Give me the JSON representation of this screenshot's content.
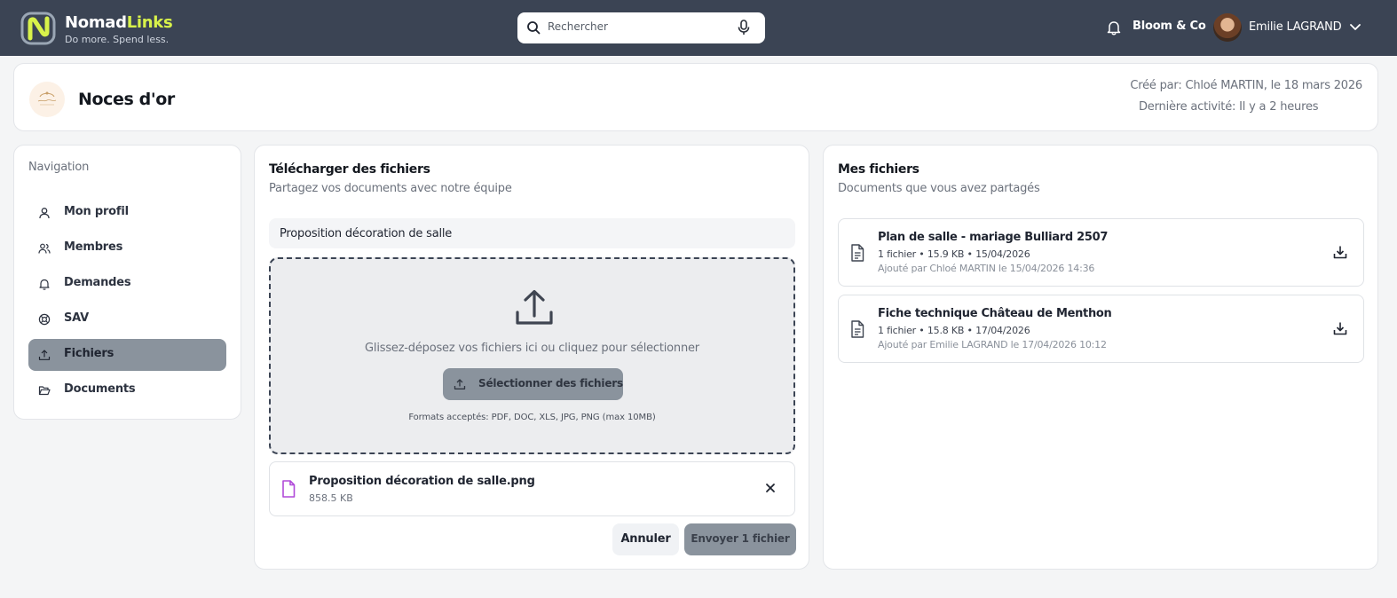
{
  "app": {
    "brand_part1": "Nomad",
    "brand_part2": "Links",
    "tagline": "Do more. Spend less.",
    "accent_color": "#d8f24a",
    "topbar_color": "#3b4454"
  },
  "search": {
    "placeholder": "Rechercher",
    "icon": "search-icon",
    "mic_icon": "microphone-icon"
  },
  "user": {
    "organization": "Bloom & Co",
    "name": "Emilie LAGRAND"
  },
  "project": {
    "title": "Noces d'or",
    "created": "Créé par: Chloé MARTIN, le 18 mars 2026",
    "last_activity": "Dernière activité: Il y a 2 heures"
  },
  "navigation": {
    "title": "Navigation",
    "items": [
      {
        "label": "Mon profil",
        "icon": "user-icon",
        "active": false
      },
      {
        "label": "Membres",
        "icon": "users-icon",
        "active": false
      },
      {
        "label": "Demandes",
        "icon": "bell-icon",
        "active": false
      },
      {
        "label": "SAV",
        "icon": "lifebuoy-icon",
        "active": false
      },
      {
        "label": "Fichiers",
        "icon": "upload-icon",
        "active": true
      },
      {
        "label": "Documents",
        "icon": "folder-open-icon",
        "active": false
      }
    ]
  },
  "upload": {
    "title": "Télécharger des fichiers",
    "subtitle": "Partagez vos documents avec notre équipe",
    "name_value": "Proposition décoration de salle",
    "drop_text": "Glissez-déposez vos fichiers ici ou cliquez pour sélectionner",
    "select_label": "Sélectionner des fichiers",
    "formats": "Formats acceptés: PDF, DOC, XLS, JPG, PNG (max 10MB)",
    "pending_file": {
      "name": "Proposition décoration de salle.png",
      "size": "858.5 KB",
      "icon_color": "#b04ad9"
    },
    "cancel_label": "Annuler",
    "send_label": "Envoyer 1 fichier"
  },
  "my_files": {
    "title": "Mes fichiers",
    "subtitle": "Documents que vous avez partagés",
    "items": [
      {
        "name": "Plan de salle - mariage Bulliard 2507",
        "meta": "1 fichier • 15.9 KB • 15/04/2026",
        "added": "Ajouté par Chloé MARTIN le 15/04/2026 14:36"
      },
      {
        "name": "Fiche technique Château de Menthon",
        "meta": "1 fichier • 15.8 KB • 17/04/2026",
        "added": "Ajouté par Emilie LAGRAND le 17/04/2026 10:12"
      }
    ]
  }
}
